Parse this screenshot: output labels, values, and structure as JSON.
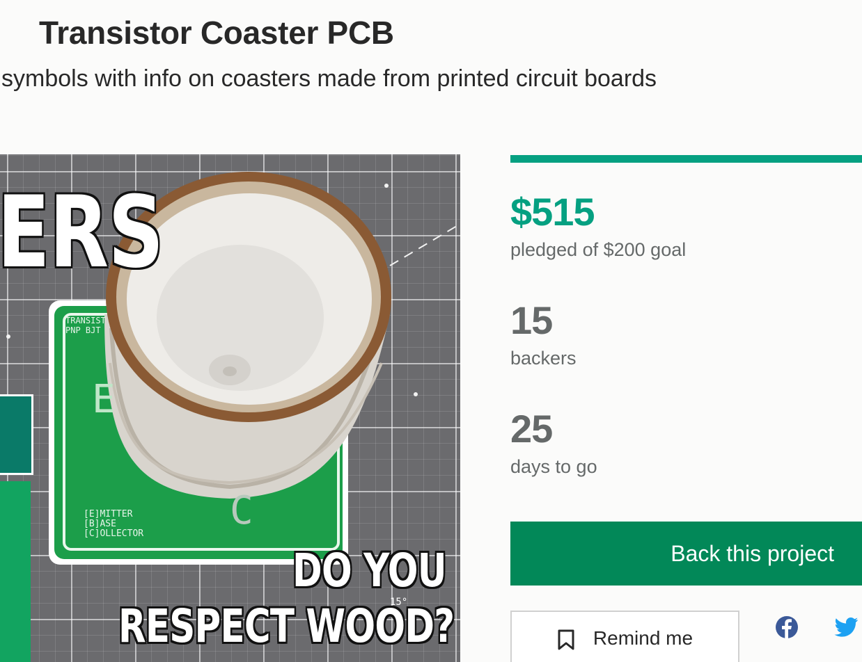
{
  "project": {
    "title": "Transistor Coaster PCB",
    "blurb": "symbols with info on coasters made from printed circuit boards"
  },
  "media": {
    "overlay_top": "ERS",
    "overlay_line1": "DO YOU",
    "overlay_line2": "RESPECT WOOD?",
    "pcb_header_1": "TRANSIST",
    "pcb_header_2": "PNP BJT",
    "pcb_letter_e": "E",
    "pcb_letter_c": "C",
    "pcb_legend_1": "[E]MITTER",
    "pcb_legend_2": "[B]ASE",
    "pcb_legend_3": "[C]OLLECTOR",
    "mat_marking": "15°"
  },
  "funding": {
    "progress_fraction": 1.0,
    "pledged": "$515",
    "pledged_label": "pledged of $200 goal",
    "backers": "15",
    "backers_label": "backers",
    "days": "25",
    "days_label": "days to go"
  },
  "actions": {
    "back_label": "Back this project",
    "remind_label": "Remind me"
  },
  "icons": {
    "bookmark": "bookmark-icon",
    "facebook": "facebook-icon",
    "twitter": "twitter-icon"
  },
  "colors": {
    "accent": "#05a081",
    "button": "#028858",
    "facebook": "#3b5998",
    "twitter": "#1da1f2",
    "pcb_green": "#1c9e4a"
  }
}
